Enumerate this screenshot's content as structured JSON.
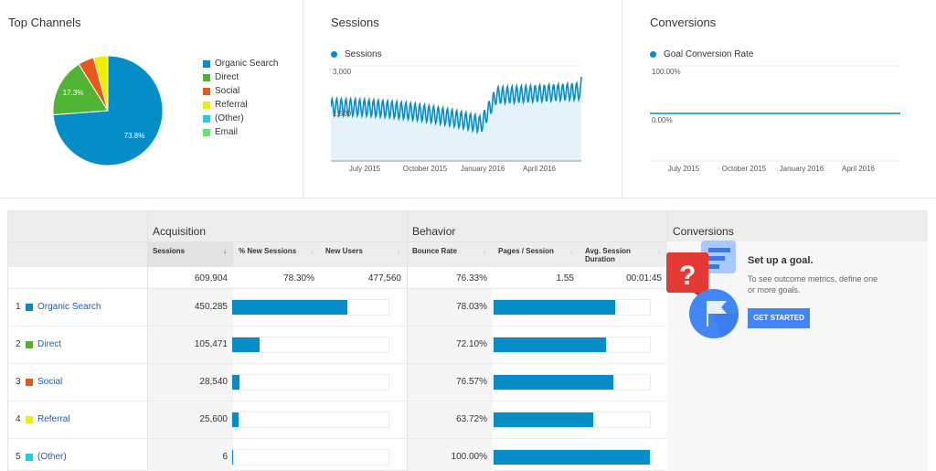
{
  "top_channels": {
    "title": "Top Channels",
    "legend": [
      {
        "label": "Organic Search",
        "color": "#058dc7"
      },
      {
        "label": "Direct",
        "color": "#50b432"
      },
      {
        "label": "Social",
        "color": "#ed561b"
      },
      {
        "label": "Referral",
        "color": "#edef00"
      },
      {
        "label": "(Other)",
        "color": "#24cbe5"
      },
      {
        "label": "Email",
        "color": "#64e572"
      }
    ],
    "slice_labels": {
      "organic": "73.8%",
      "direct": "17.3%"
    }
  },
  "sessions_panel": {
    "title": "Sessions",
    "series_label": "Sessions",
    "y_ticks": [
      "3,000",
      "1,500"
    ],
    "x_ticks": [
      "July 2015",
      "October 2015",
      "January 2016",
      "April 2016"
    ]
  },
  "conversions_panel": {
    "title": "Conversions",
    "series_label": "Goal Conversion Rate",
    "y_ticks": [
      "100.00%",
      "0.00%"
    ],
    "x_ticks": [
      "July 2015",
      "October 2015",
      "January 2016",
      "April 2016"
    ]
  },
  "chart_data": [
    {
      "type": "pie",
      "title": "Top Channels",
      "categories": [
        "Organic Search",
        "Direct",
        "Social",
        "Referral",
        "(Other)",
        "Email"
      ],
      "values": [
        73.8,
        17.3,
        4.7,
        4.2,
        0.0,
        0.0
      ],
      "colors": [
        "#058dc7",
        "#50b432",
        "#ed561b",
        "#edef00",
        "#24cbe5",
        "#64e572"
      ],
      "legend": "right"
    },
    {
      "type": "area",
      "title": "Sessions",
      "x": [
        "July 2015",
        "October 2015",
        "January 2016",
        "April 2016"
      ],
      "ylim": [
        0,
        3000
      ],
      "y_ticks": [
        1500,
        3000
      ],
      "weekly_pattern": {
        "baseline_start": 1700,
        "baseline_dip_jan2016": 1150,
        "baseline_end": 2200,
        "amplitude": 300,
        "final_spike": 2650
      },
      "color": "#058dc7",
      "grid": true
    },
    {
      "type": "line",
      "title": "Conversions",
      "series": [
        {
          "name": "Goal Conversion Rate",
          "values": [
            0,
            0,
            0,
            0
          ]
        }
      ],
      "x": [
        "July 2015",
        "October 2015",
        "January 2016",
        "April 2016"
      ],
      "ylim": [
        0,
        100
      ],
      "y_ticks": [
        "0.00%",
        "100.00%"
      ]
    }
  ],
  "table": {
    "groups": {
      "acquisition": "Acquisition",
      "behavior": "Behavior",
      "conversions": "Conversions"
    },
    "columns": {
      "sessions": "Sessions",
      "pct_new_sessions": "% New Sessions",
      "new_users": "New Users",
      "bounce_rate": "Bounce Rate",
      "pages_session": "Pages / Session",
      "avg_duration": "Avg. Session Duration"
    },
    "sort_icon": "↓",
    "totals": {
      "sessions": "609,904",
      "pct_new_sessions": "78.30%",
      "new_users": "477,560",
      "bounce_rate": "76.33%",
      "pages_session": "1.55",
      "avg_duration": "00:01:45"
    },
    "rows": [
      {
        "idx": "1",
        "channel": "Organic Search",
        "color": "#058dc7",
        "sessions": "450,285",
        "sessions_share": 0.738,
        "bounce_rate": "78.03%",
        "bounce_share": 0.7803
      },
      {
        "idx": "2",
        "channel": "Direct",
        "color": "#50b432",
        "sessions": "105,471",
        "sessions_share": 0.173,
        "bounce_rate": "72.10%",
        "bounce_share": 0.721
      },
      {
        "idx": "3",
        "channel": "Social",
        "color": "#ed561b",
        "sessions": "28,540",
        "sessions_share": 0.047,
        "bounce_rate": "76.57%",
        "bounce_share": 0.7657
      },
      {
        "idx": "4",
        "channel": "Referral",
        "color": "#edef00",
        "sessions": "25,600",
        "sessions_share": 0.042,
        "bounce_rate": "63.72%",
        "bounce_share": 0.6372
      },
      {
        "idx": "5",
        "channel": "(Other)",
        "color": "#24cbe5",
        "sessions": "6",
        "sessions_share": 1e-05,
        "bounce_rate": "100.00%",
        "bounce_share": 1.0
      }
    ]
  },
  "goal_cta": {
    "title": "Set up a goal.",
    "description": "To see outcome metrics, define one or more goals.",
    "button": "GET STARTED"
  }
}
